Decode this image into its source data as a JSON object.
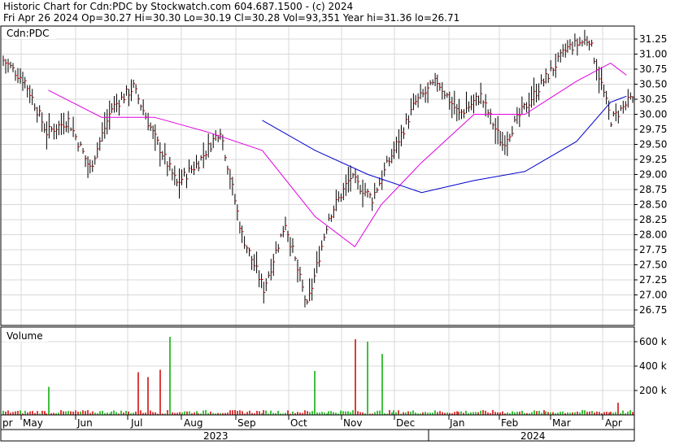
{
  "header": {
    "line1": "Historic Chart for Cdn:PDC by Stockwatch.com 604.687.1500 - (c) 2024",
    "line2": "Fri Apr 26 2024   Op=30.27  Hi=30.30  Lo=30.19  Cl=30.28  Vol=93,351  Year hi=31.36  lo=26.71"
  },
  "price_panel_label": "Cdn:PDC",
  "volume_panel_label": "Volume",
  "colors": {
    "background": "#ffffff",
    "border": "#000000",
    "grid": "#d8d8d8",
    "price_bar": "#000000",
    "close_tick": "#cc0000",
    "ma_short": "#e000e0",
    "ma_long": "#0000cc",
    "volume_up": "#00aa00",
    "volume_down": "#cc0000"
  },
  "chart_data": [
    {
      "type": "ohlc",
      "title": "Historic Chart for Cdn:PDC by Stockwatch.com 604.687.1500 - (c) 2024",
      "ylabel": "",
      "ylim": [
        26.5,
        31.4
      ],
      "y_ticks": [
        "31.25",
        "31.00",
        "30.75",
        "30.50",
        "30.25",
        "30.00",
        "29.75",
        "29.50",
        "29.25",
        "29.00",
        "28.75",
        "28.50",
        "28.25",
        "28.00",
        "27.75",
        "27.50",
        "27.25",
        "27.00",
        "26.75"
      ],
      "x_month_labels": [
        "pr",
        "May",
        "Jun",
        "Jul",
        "Aug",
        "Sep",
        "Oct",
        "Nov",
        "Dec",
        "Jan",
        "Feb",
        "Mar",
        "Apr"
      ],
      "x_year_labels": [
        "2023",
        "2024"
      ],
      "grid": true,
      "series": [
        {
          "name": "Cdn:PDC",
          "style": "ohlc bars (vertical high-low with close tick)",
          "close_points": [
            {
              "month": "pr",
              "close": 30.9
            },
            {
              "month": "May",
              "close": 30.55
            },
            {
              "month": "May",
              "close": 29.7
            },
            {
              "month": "Jun",
              "close": 29.9
            },
            {
              "month": "Jun",
              "close": 29.1
            },
            {
              "month": "Jul",
              "close": 30.1
            },
            {
              "month": "Jul",
              "close": 30.45
            },
            {
              "month": "Aug",
              "close": 29.6
            },
            {
              "month": "Aug",
              "close": 28.85
            },
            {
              "month": "Sep",
              "close": 29.2
            },
            {
              "month": "Sep",
              "close": 29.75
            },
            {
              "month": "Oct",
              "close": 28.0
            },
            {
              "month": "Oct",
              "close": 27.1
            },
            {
              "month": "Oct",
              "close": 28.2
            },
            {
              "month": "Oct",
              "close": 26.8
            },
            {
              "month": "Nov",
              "close": 28.3
            },
            {
              "month": "Nov",
              "close": 28.95
            },
            {
              "month": "Nov",
              "close": 28.6
            },
            {
              "month": "Dec",
              "close": 29.4
            },
            {
              "month": "Dec",
              "close": 30.2
            },
            {
              "month": "Jan",
              "close": 30.55
            },
            {
              "month": "Jan",
              "close": 30.0
            },
            {
              "month": "Jan",
              "close": 30.3
            },
            {
              "month": "Feb",
              "close": 29.5
            },
            {
              "month": "Feb",
              "close": 30.1
            },
            {
              "month": "Mar",
              "close": 30.6
            },
            {
              "month": "Mar",
              "close": 31.1
            },
            {
              "month": "Mar",
              "close": 31.25
            },
            {
              "month": "Apr",
              "close": 29.9
            },
            {
              "month": "Apr",
              "close": 30.28
            }
          ]
        },
        {
          "name": "short moving average",
          "color": "magenta",
          "points": [
            {
              "month": "May",
              "value": 30.4
            },
            {
              "month": "Jun",
              "value": 29.95
            },
            {
              "month": "Jul",
              "value": 29.95
            },
            {
              "month": "Aug",
              "value": 29.7
            },
            {
              "month": "Sep",
              "value": 29.4
            },
            {
              "month": "Oct",
              "value": 28.3
            },
            {
              "month": "Nov",
              "value": 27.8
            },
            {
              "month": "Nov",
              "value": 28.5
            },
            {
              "month": "Dec",
              "value": 29.2
            },
            {
              "month": "Jan",
              "value": 30.0
            },
            {
              "month": "Feb",
              "value": 30.0
            },
            {
              "month": "Mar",
              "value": 30.55
            },
            {
              "month": "Apr",
              "value": 30.85
            },
            {
              "month": "Apr",
              "value": 30.65
            }
          ]
        },
        {
          "name": "long moving average",
          "color": "blue",
          "points": [
            {
              "month": "Sep",
              "value": 29.9
            },
            {
              "month": "Oct",
              "value": 29.4
            },
            {
              "month": "Nov",
              "value": 29.0
            },
            {
              "month": "Dec",
              "value": 28.7
            },
            {
              "month": "Jan",
              "value": 28.9
            },
            {
              "month": "Feb",
              "value": 29.05
            },
            {
              "month": "Mar",
              "value": 29.55
            },
            {
              "month": "Apr",
              "value": 30.2
            },
            {
              "month": "Apr",
              "value": 30.3
            }
          ]
        }
      ]
    },
    {
      "type": "bar",
      "title": "Volume",
      "ylim": [
        0,
        700000
      ],
      "y_ticks": [
        "600 k",
        "400 k",
        "200 k"
      ],
      "grid": true,
      "note": "daily volume bars; green = up day, red = down day; mostly small with spikes",
      "spikes": [
        {
          "month": "May",
          "value": 230000
        },
        {
          "month": "Jul",
          "value": 350000
        },
        {
          "month": "Jul",
          "value": 310000
        },
        {
          "month": "Jul",
          "value": 370000
        },
        {
          "month": "Jul",
          "value": 640000
        },
        {
          "month": "Oct",
          "value": 360000
        },
        {
          "month": "Nov",
          "value": 620000
        },
        {
          "month": "Nov",
          "value": 600000
        },
        {
          "month": "Nov",
          "value": 500000
        },
        {
          "month": "Apr",
          "value": 100000
        }
      ]
    }
  ]
}
